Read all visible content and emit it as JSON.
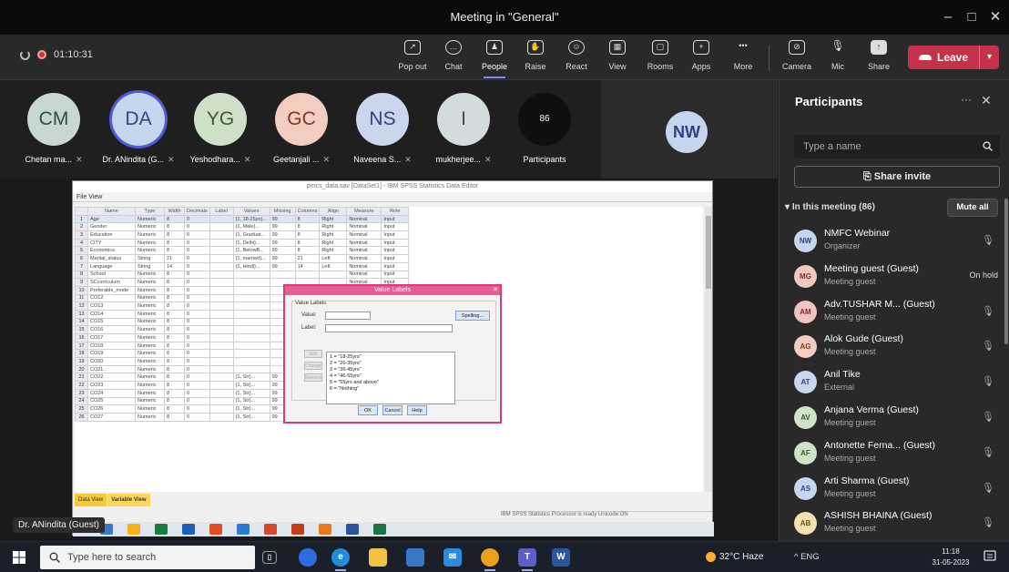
{
  "window": {
    "title": "Meeting in \"General\"",
    "minimize": "–",
    "maximize": "□",
    "close": "✕"
  },
  "toolbar": {
    "timer": "01:10:31",
    "buttons": [
      {
        "label": "Pop out",
        "icon": "popout-icon"
      },
      {
        "label": "Chat",
        "icon": "chat-icon"
      },
      {
        "label": "People",
        "icon": "people-icon"
      },
      {
        "label": "Raise",
        "icon": "raise-hand-icon"
      },
      {
        "label": "React",
        "icon": "react-icon"
      },
      {
        "label": "View",
        "icon": "view-icon"
      },
      {
        "label": "Rooms",
        "icon": "rooms-icon"
      },
      {
        "label": "Apps",
        "icon": "apps-icon"
      },
      {
        "label": "More",
        "icon": "more-icon"
      }
    ],
    "media": [
      {
        "label": "Camera",
        "icon": "camera-off-icon"
      },
      {
        "label": "Mic",
        "icon": "mic-off-icon"
      },
      {
        "label": "Share",
        "icon": "share-icon"
      }
    ],
    "leave": "Leave"
  },
  "strip": {
    "tiles": [
      {
        "initials": "CM",
        "name": "Chetan ma...",
        "bg": "#c8d7d3",
        "fg": "#2f4f47"
      },
      {
        "initials": "DA",
        "name": "Dr. ANindita (G...",
        "bg": "#c4d7ef",
        "fg": "#2c4a7a"
      },
      {
        "initials": "YG",
        "name": "Yeshodhara...",
        "bg": "#cfe0c8",
        "fg": "#3c5a2f"
      },
      {
        "initials": "GC",
        "name": "Geetanjali ...",
        "bg": "#f3cdbf",
        "fg": "#7b3a26"
      },
      {
        "initials": "NS",
        "name": "Naveena S...",
        "bg": "#c9d6ee",
        "fg": "#33427a"
      },
      {
        "initials": "I",
        "name": "mukherjee...",
        "bg": "#d3dcdc",
        "fg": "#3c4a4a"
      },
      {
        "initials": "86",
        "name": "Participants",
        "bg": "#0f0f0f",
        "fg": "#ffffff"
      }
    ],
    "screen_sharer": "NW"
  },
  "spss": {
    "title": "pmcs_data.sav [DataSet1] - IBM SPSS Statistics Data Editor",
    "menu": "File  View",
    "columns": [
      "",
      "Name",
      "Type",
      "Width",
      "Decimals",
      "Label",
      "Values",
      "Missing",
      "Columns",
      "Align",
      "Measure",
      "Role"
    ],
    "rows": [
      [
        "1",
        "Age",
        "Numeric",
        "8",
        "0",
        "",
        "{1, 18-25ye}...",
        "99",
        "8",
        "Right",
        "Nominal",
        "Input"
      ],
      [
        "2",
        "Gender",
        "Numeric",
        "8",
        "0",
        "",
        "{1, Male}...",
        "99",
        "8",
        "Right",
        "Nominal",
        "Input"
      ],
      [
        "3",
        "Education",
        "Numeric",
        "8",
        "0",
        "",
        "{1, Graduat...",
        "99",
        "8",
        "Right",
        "Nominal",
        "Input"
      ],
      [
        "4",
        "CITY",
        "Numeric",
        "8",
        "0",
        "",
        "{1, Delhi}...",
        "99",
        "8",
        "Right",
        "Nominal",
        "Input"
      ],
      [
        "5",
        "Economics",
        "Numeric",
        "8",
        "0",
        "",
        "{1, BelowB...",
        "99",
        "8",
        "Right",
        "Nominal",
        "Input"
      ],
      [
        "6",
        "Marital_status",
        "String",
        "21",
        "0",
        "",
        "{1, married}...",
        "99",
        "21",
        "Left",
        "Nominal",
        "Input"
      ],
      [
        "7",
        "Language",
        "String",
        "14",
        "0",
        "",
        "{1, Hindi}...",
        "99",
        "14",
        "Left",
        "Nominal",
        "Input"
      ],
      [
        "8",
        "School",
        "Numeric",
        "8",
        "0",
        "",
        "",
        "",
        "",
        "",
        "Nominal",
        "Input"
      ],
      [
        "9",
        "SCcurriculum",
        "Numeric",
        "8",
        "0",
        "",
        "",
        "",
        "",
        "",
        "Nominal",
        "Input"
      ],
      [
        "10",
        "Preferable_mode",
        "Numeric",
        "8",
        "0",
        "",
        "",
        "",
        "",
        "",
        "Nominal",
        "Input"
      ],
      [
        "11",
        "CO12",
        "Numeric",
        "8",
        "0",
        "",
        "",
        "",
        "",
        "",
        "Scale",
        "Both"
      ],
      [
        "12",
        "CO13",
        "Numeric",
        "8",
        "0",
        "",
        "",
        "",
        "",
        "",
        "Scale",
        "Both"
      ],
      [
        "13",
        "CO14",
        "Numeric",
        "8",
        "0",
        "",
        "",
        "",
        "",
        "",
        "Scale",
        "Both"
      ],
      [
        "14",
        "CO15",
        "Numeric",
        "8",
        "0",
        "",
        "",
        "",
        "",
        "",
        "Scale",
        "Both"
      ],
      [
        "15",
        "CO16",
        "Numeric",
        "8",
        "0",
        "",
        "",
        "",
        "",
        "",
        "Scale",
        "Both"
      ],
      [
        "16",
        "CO17",
        "Numeric",
        "8",
        "0",
        "",
        "",
        "",
        "",
        "",
        "Scale",
        "Both"
      ],
      [
        "17",
        "CO18",
        "Numeric",
        "8",
        "0",
        "",
        "",
        "",
        "",
        "",
        "Scale",
        "Both"
      ],
      [
        "18",
        "CO19",
        "Numeric",
        "8",
        "0",
        "",
        "",
        "",
        "",
        "",
        "Scale",
        "Both"
      ],
      [
        "19",
        "CO20",
        "Numeric",
        "8",
        "0",
        "",
        "",
        "",
        "",
        "",
        "Scale",
        "Both"
      ],
      [
        "20",
        "CO21",
        "Numeric",
        "8",
        "0",
        "",
        "",
        "",
        "",
        "",
        "Scale",
        "Both"
      ],
      [
        "21",
        "CO22",
        "Numeric",
        "8",
        "0",
        "",
        "{1, Str}...",
        "99",
        "8",
        "Right",
        "Scale",
        "Both"
      ],
      [
        "22",
        "CO23",
        "Numeric",
        "8",
        "0",
        "",
        "{1, Str}...",
        "99",
        "8",
        "Right",
        "Scale",
        "Both"
      ],
      [
        "23",
        "CO24",
        "Numeric",
        "8",
        "0",
        "",
        "{1, Str}...",
        "99",
        "8",
        "Right",
        "Scale",
        "Both"
      ],
      [
        "24",
        "CO25",
        "Numeric",
        "8",
        "0",
        "",
        "{1, Str}...",
        "99",
        "8",
        "Right",
        "Scale",
        "Both"
      ],
      [
        "25",
        "CO26",
        "Numeric",
        "8",
        "0",
        "",
        "{1, Str}...",
        "99",
        "8",
        "Right",
        "Scale",
        "Both"
      ],
      [
        "26",
        "CO27",
        "Numeric",
        "8",
        "0",
        "",
        "{1, Str}...",
        "99",
        "8",
        "Right",
        "Scale",
        "Both"
      ]
    ],
    "tabs": [
      "Data View",
      "Variable View"
    ],
    "status": "IBM SPSS Statistics Processor is ready     Unicode:ON"
  },
  "dialog": {
    "title": "Value Labels",
    "group": "Value Labels",
    "value_label": "Value:",
    "label_label": "Label:",
    "spelling": "Spelling...",
    "side_buttons": [
      "Add",
      "Change",
      "Remove"
    ],
    "list": [
      "1 = \"18-25yrs\"",
      "2 = \"26-35yrs\"",
      "3 = \"36-45yrs\"",
      "4 = \"46-55yrs\"",
      "5 = \"55yrs and above\"",
      "6 = \"Nothing\""
    ],
    "buttons": [
      "OK",
      "Cancel",
      "Help"
    ]
  },
  "presenter_badge": "Dr. ANindita (Guest)",
  "participants": {
    "title": "Participants",
    "search_placeholder": "Type a name",
    "share_invite": "Share invite",
    "in_meeting": "In this meeting (86)",
    "mute_all": "Mute all",
    "list": [
      {
        "initials": "NW",
        "name": "NMFC Webinar",
        "role": "Organizer",
        "bg": "#c5d5ee",
        "fg": "#30427a",
        "state": ""
      },
      {
        "initials": "MG",
        "name": "Meeting guest (Guest)",
        "role": "Meeting guest",
        "bg": "#f1c9c0",
        "fg": "#7b3326",
        "state": "On hold"
      },
      {
        "initials": "AM",
        "name": "Adv.TUSHAR M...  (Guest)",
        "role": "Meeting guest",
        "bg": "#f1c3c3",
        "fg": "#7a2b2b",
        "state": ""
      },
      {
        "initials": "AG",
        "name": "Alok Gude (Guest)",
        "role": "Meeting guest",
        "bg": "#f3cdbf",
        "fg": "#7b3a26",
        "state": ""
      },
      {
        "initials": "AT",
        "name": "Anil Tike",
        "role": "External",
        "bg": "#c9d6ee",
        "fg": "#33427a",
        "state": ""
      },
      {
        "initials": "AV",
        "name": "Anjana Verma (Guest)",
        "role": "Meeting guest",
        "bg": "#cfe4c6",
        "fg": "#3c5a2f",
        "state": ""
      },
      {
        "initials": "AF",
        "name": "Antonette Ferna...  (Guest)",
        "role": "Meeting guest",
        "bg": "#cfe4c6",
        "fg": "#3c5a2f",
        "state": ""
      },
      {
        "initials": "AS",
        "name": "Arti Sharma (Guest)",
        "role": "Meeting guest",
        "bg": "#c4d7ef",
        "fg": "#2c4a7a",
        "state": ""
      },
      {
        "initials": "AB",
        "name": "ASHISH BHAINA (Guest)",
        "role": "Meeting guest",
        "bg": "#f5e1b0",
        "fg": "#6b5011",
        "state": ""
      }
    ]
  },
  "taskbar": {
    "search_placeholder": "Type here to search",
    "weather": "32°C  Haze",
    "tray": "^  ENG",
    "time": "11:18",
    "date": "31-05-2023"
  }
}
